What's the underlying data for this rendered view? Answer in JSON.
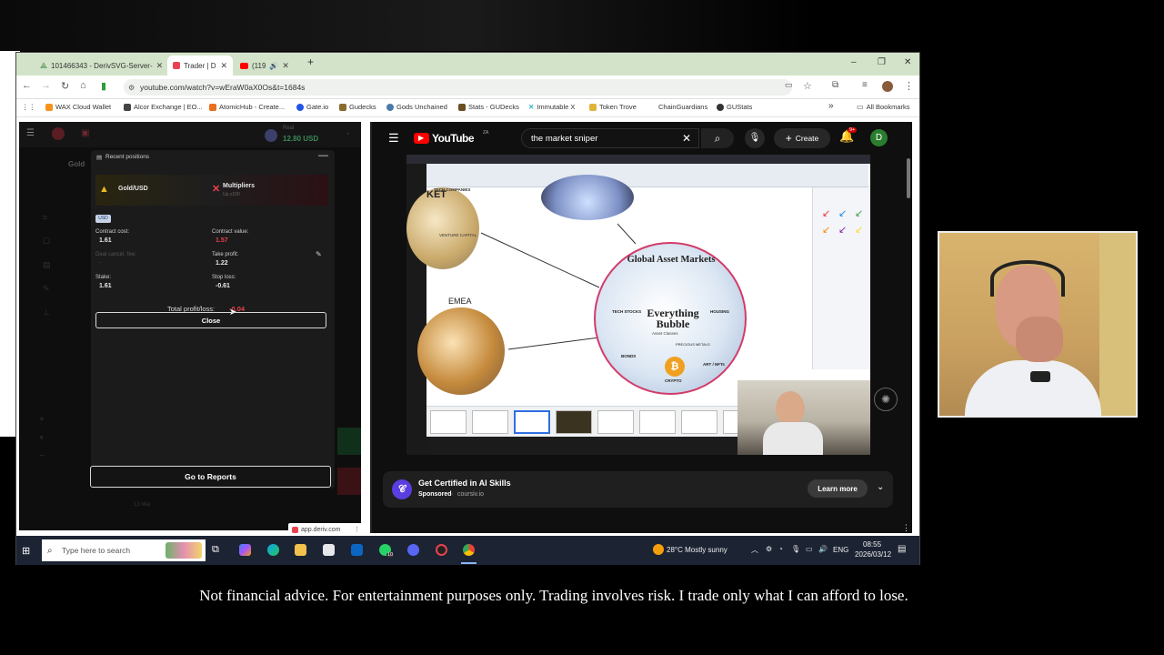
{
  "browser": {
    "tabs": [
      {
        "label": "101466343 - DerivSVG-Server-"
      },
      {
        "label": "Trader | D"
      },
      {
        "label": "(119"
      }
    ],
    "new_tab": "+",
    "window_controls": {
      "minimize": "–",
      "restore": "❐",
      "close": "✕"
    },
    "url": "youtube.com/watch?v=wEraW0aX0Os&t=1684s",
    "bookmarks": [
      {
        "label": "WAX Cloud Wallet"
      },
      {
        "label": "Alcor Exchange | EO..."
      },
      {
        "label": "AtomicHub - Create..."
      },
      {
        "label": "Gate.io"
      },
      {
        "label": "Gudecks"
      },
      {
        "label": "Gods Unchained"
      },
      {
        "label": "Stats - GUDecks"
      },
      {
        "label": "Immutable X"
      },
      {
        "label": "Token Trove"
      },
      {
        "label": "ChainGuardians"
      },
      {
        "label": "GUStats"
      }
    ],
    "all_bookmarks": "All Bookmarks",
    "more_bookmarks": "»"
  },
  "deriv": {
    "account_type": "Real",
    "balance": "12.80 USD",
    "panel_title": "Recent positions",
    "asset": "Gold/USD",
    "contract_type": "Multipliers",
    "multiplier": "Up x100",
    "badge": "USD",
    "contract_cost_label": "Contract cost:",
    "contract_cost": "1.61",
    "contract_value_label": "Contract value:",
    "contract_value": "1.57",
    "deal_cancel_label": "Deal cancel. fee:",
    "deal_cancel_value": "-",
    "take_profit_label": "Take profit:",
    "take_profit": "1.22",
    "stake_label": "Stake:",
    "stake": "1.61",
    "stop_loss_label": "Stop loss:",
    "stop_loss": "-0.61",
    "total_pl_label": "Total profit/loss:",
    "total_pl": "-0.04",
    "close_label": "Close",
    "reports_label": "Go to Reports",
    "chart_date": "13 Mar",
    "site_url": "app.deriv.com",
    "asset_short": "Gold"
  },
  "youtube": {
    "logo": "YouTube",
    "region": "ZA",
    "search_value": "the market sniper",
    "create_label": "Create",
    "notif_count": "9+",
    "avatar_letter": "D",
    "video_labels": {
      "ket": "KET",
      "tech": "TECH COMPANIES",
      "venture": "VENTURE CAPITAL",
      "emea": "EMEA",
      "global": "Global Asset Markets",
      "bubble": "Everything Bubble",
      "asset_classes": "Asset Classes",
      "tech_stocks": "TECH STOCKS",
      "housing": "HOUSING",
      "bonds": "BONDS",
      "crypto": "CRYPTO",
      "art": "ART / NFTs",
      "precious": "PRECIOUS METALS"
    },
    "ad_title": "Get Certified in AI Skills",
    "ad_sponsored": "Sponsored",
    "ad_domain": "coursiv.io",
    "learn_more": "Learn more"
  },
  "taskbar": {
    "search_placeholder": "Type here to search",
    "weather": "28°C  Mostly sunny",
    "lang": "ENG",
    "time": "08:55",
    "date": "2026/03/12",
    "whatsapp_count": "10"
  },
  "disclaimer": "Not financial advice. For entertainment purposes only. Trading involves risk. I trade only what I can afford to lose.",
  "colors": {
    "tabbar": "#d3e3c9",
    "deriv_bg": "#0e0e0e",
    "loss_red": "#e9424f",
    "youtube_red": "#ff0000",
    "taskbar": "#1c2333"
  }
}
